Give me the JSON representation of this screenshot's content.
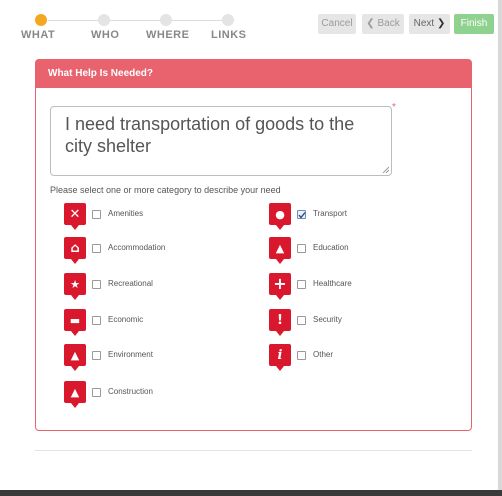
{
  "stepper": {
    "steps": [
      {
        "label": "WHAT",
        "active": true
      },
      {
        "label": "WHO",
        "active": false
      },
      {
        "label": "WHERE",
        "active": false
      },
      {
        "label": "LINKS",
        "active": false
      }
    ]
  },
  "buttons": {
    "cancel": "Cancel",
    "back": "Back",
    "next": "Next",
    "finish": "Finish"
  },
  "panel": {
    "title": "What Help Is Needed?",
    "description_value": "I need transportation of goods to the city shelter",
    "required_marker": "*",
    "instruction": "Please select one or more category to describe your need"
  },
  "categories": [
    {
      "label": "Amenities",
      "icon": "tools-icon",
      "checked": false
    },
    {
      "label": "Transport",
      "icon": "car-icon",
      "checked": true
    },
    {
      "label": "Accommodation",
      "icon": "home-icon",
      "checked": false
    },
    {
      "label": "Education",
      "icon": "graduation-cap-icon",
      "checked": false
    },
    {
      "label": "Recreational",
      "icon": "recreation-icon",
      "checked": false
    },
    {
      "label": "Healthcare",
      "icon": "medical-cross-icon",
      "checked": false
    },
    {
      "label": "Economic",
      "icon": "handshake-icon",
      "checked": false
    },
    {
      "label": "Security",
      "icon": "warning-icon",
      "checked": false
    },
    {
      "label": "Environment",
      "icon": "worker-icon",
      "checked": false
    },
    {
      "label": "Other",
      "icon": "info-icon",
      "checked": false
    },
    {
      "label": "Construction",
      "icon": "construction-worker-icon",
      "checked": false
    }
  ],
  "colors": {
    "accent": "#e8636e",
    "icon_red": "#d9182e",
    "step_active": "#f5a623",
    "finish_green": "#8fd18f"
  }
}
